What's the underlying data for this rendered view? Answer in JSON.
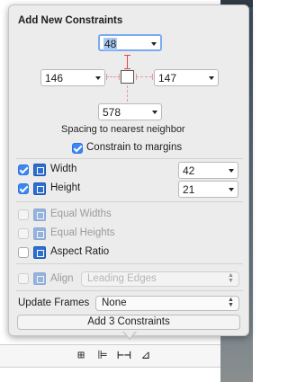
{
  "popover": {
    "title": "Add New Constraints",
    "spacing": {
      "top": "48",
      "left": "146",
      "right": "147",
      "bottom": "578",
      "caption": "Spacing to nearest neighbor"
    },
    "constrain_to_margins": {
      "label": "Constrain to margins",
      "checked": true
    },
    "size": {
      "width": {
        "label": "Width",
        "checked": true,
        "value": "42"
      },
      "height": {
        "label": "Height",
        "checked": true,
        "value": "21"
      }
    },
    "options": {
      "equal_widths": {
        "label": "Equal Widths",
        "checked": false,
        "enabled": false
      },
      "equal_heights": {
        "label": "Equal Heights",
        "checked": false,
        "enabled": false
      },
      "aspect_ratio": {
        "label": "Aspect Ratio",
        "checked": false,
        "enabled": true
      }
    },
    "align": {
      "label": "Align",
      "value": "Leading Edges",
      "enabled": false
    },
    "update_frames": {
      "label": "Update Frames",
      "value": "None"
    },
    "add_button": "Add 3 Constraints"
  },
  "toolbar": {
    "icons": [
      "embed-in-stack-icon",
      "align-icon",
      "add-constraints-icon",
      "resolve-issues-icon"
    ]
  },
  "colors": {
    "accent": "#3b87f5",
    "constraint_red": "#e0464f",
    "constraint_icon": "#2e6fd0"
  }
}
